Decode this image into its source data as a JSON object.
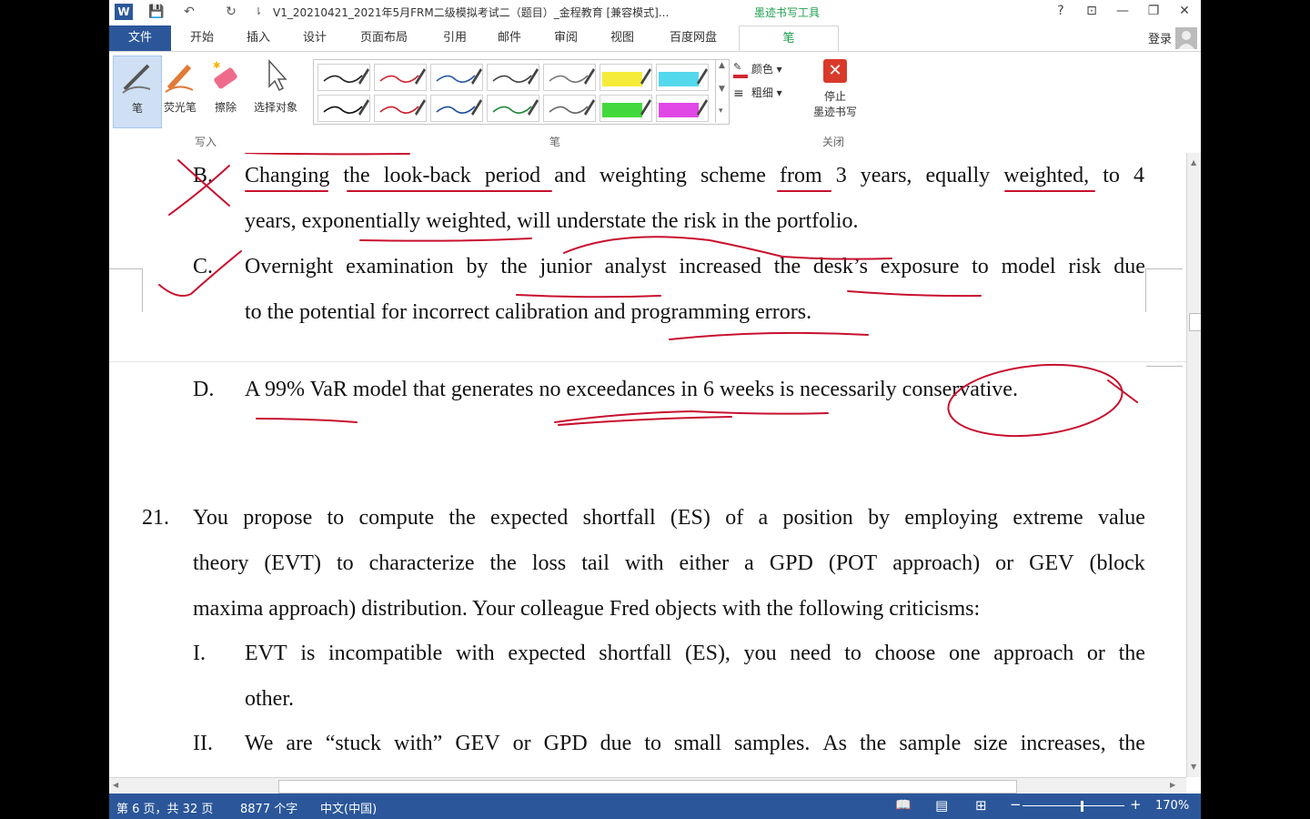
{
  "window": {
    "title": "V1_20210421_2021年5月FRM二级模拟考试二（题目）_金程教育 [兼容模式]...",
    "ink_tools_tab": "墨迹书写工具",
    "help": "?",
    "ribbon_toggle": "⊡",
    "minimize": "—",
    "restore": "❐",
    "close": "✕"
  },
  "quick_access": {
    "word_icon": "W",
    "save": "💾",
    "undo": "↶",
    "redo": "↻",
    "customize": "⇂"
  },
  "tabs": [
    "文件",
    "开始",
    "插入",
    "设计",
    "页面布局",
    "引用",
    "邮件",
    "审阅",
    "视图",
    "百度网盘",
    "笔"
  ],
  "account": {
    "login": "登录"
  },
  "ribbon": {
    "write_tools": [
      {
        "label": "笔",
        "icon": "pen-icon"
      },
      {
        "label": "荧光笔",
        "icon": "highlighter-icon"
      },
      {
        "label": "擦除",
        "icon": "eraser-icon"
      },
      {
        "label": "选择对象",
        "icon": "select-object-icon"
      }
    ],
    "write_group_label": "写入",
    "pen_group_label": "笔",
    "color_label": "颜色",
    "thickness_label": "粗细",
    "stop_label_1": "停止",
    "stop_label_2": "墨迹书写",
    "close_group_label": "关闭",
    "pens_row1": [
      "#222222",
      "#d22630",
      "#2a5aa8",
      "#444444",
      "#777777",
      "#f5ec3a",
      "#54d8ec"
    ],
    "pens_row2": [
      "#111111",
      "#cc1f2a",
      "#1e4f9c",
      "#1f8a3c",
      "#666666",
      "#43d93c",
      "#e147e6"
    ]
  },
  "document": {
    "option_b_label": "B.",
    "option_b_line1": [
      "Changing",
      "the",
      "look-back",
      "period",
      "and",
      "weighting",
      "scheme",
      "from",
      "3",
      "years,",
      "equally",
      "weighted,",
      "to",
      "4"
    ],
    "option_b_line2": "years, exponentially weighted, will understate the risk in the portfolio.",
    "option_c_label": "C.",
    "option_c_line1": [
      "Overnight",
      "examination",
      "by",
      "the",
      "junior",
      "analyst",
      "increased",
      "the",
      "desk’s",
      "exposure",
      "to",
      "model",
      "risk",
      "due"
    ],
    "option_c_line2": "to the potential for incorrect calibration and programming errors.",
    "option_d_label": "D.",
    "option_d_line1": "A 99% VaR model that generates no exceedances in 6 weeks is necessarily conservative.",
    "q21_number": "21.",
    "q21_line1": [
      "You",
      "propose",
      "to",
      "compute",
      "the",
      "expected",
      "shortfall",
      "(ES)",
      "of",
      "a",
      "position",
      "by",
      "employing",
      "extreme",
      "value"
    ],
    "q21_line2": [
      "theory",
      "(EVT)",
      "to",
      "characterize",
      "the",
      "loss",
      "tail",
      "with",
      "either",
      "a",
      "GPD",
      "(POT",
      "approach)",
      "or",
      "GEV",
      "(block"
    ],
    "q21_line3": "maxima approach) distribution. Your colleague Fred objects with the following criticisms:",
    "item_i_label": "I.",
    "item_i_line1": [
      "EVT",
      "is",
      "incompatible",
      "with",
      "expected",
      "shortfall",
      "(ES),",
      "you",
      "need",
      "to",
      "choose",
      "one",
      "approach",
      "or",
      "the"
    ],
    "item_i_line2": "other.",
    "item_ii_label": "II.",
    "item_ii_line1": [
      "We",
      "are",
      "“stuck",
      "with”",
      "GEV",
      "or",
      "GPD",
      "due",
      "to",
      "small",
      "samples.",
      "As",
      "the",
      "sample",
      "size",
      "increases,",
      "the"
    ]
  },
  "status": {
    "page": "第 6 页，共 32 页",
    "words": "8877 个字",
    "language": "中文(中国)",
    "zoom_minus": "−",
    "zoom_plus": "+",
    "zoom": "170%"
  },
  "colors": {
    "accent": "#2b579a",
    "ink_red": "#c8102e",
    "ink_tab_green": "#1e9e4f"
  }
}
